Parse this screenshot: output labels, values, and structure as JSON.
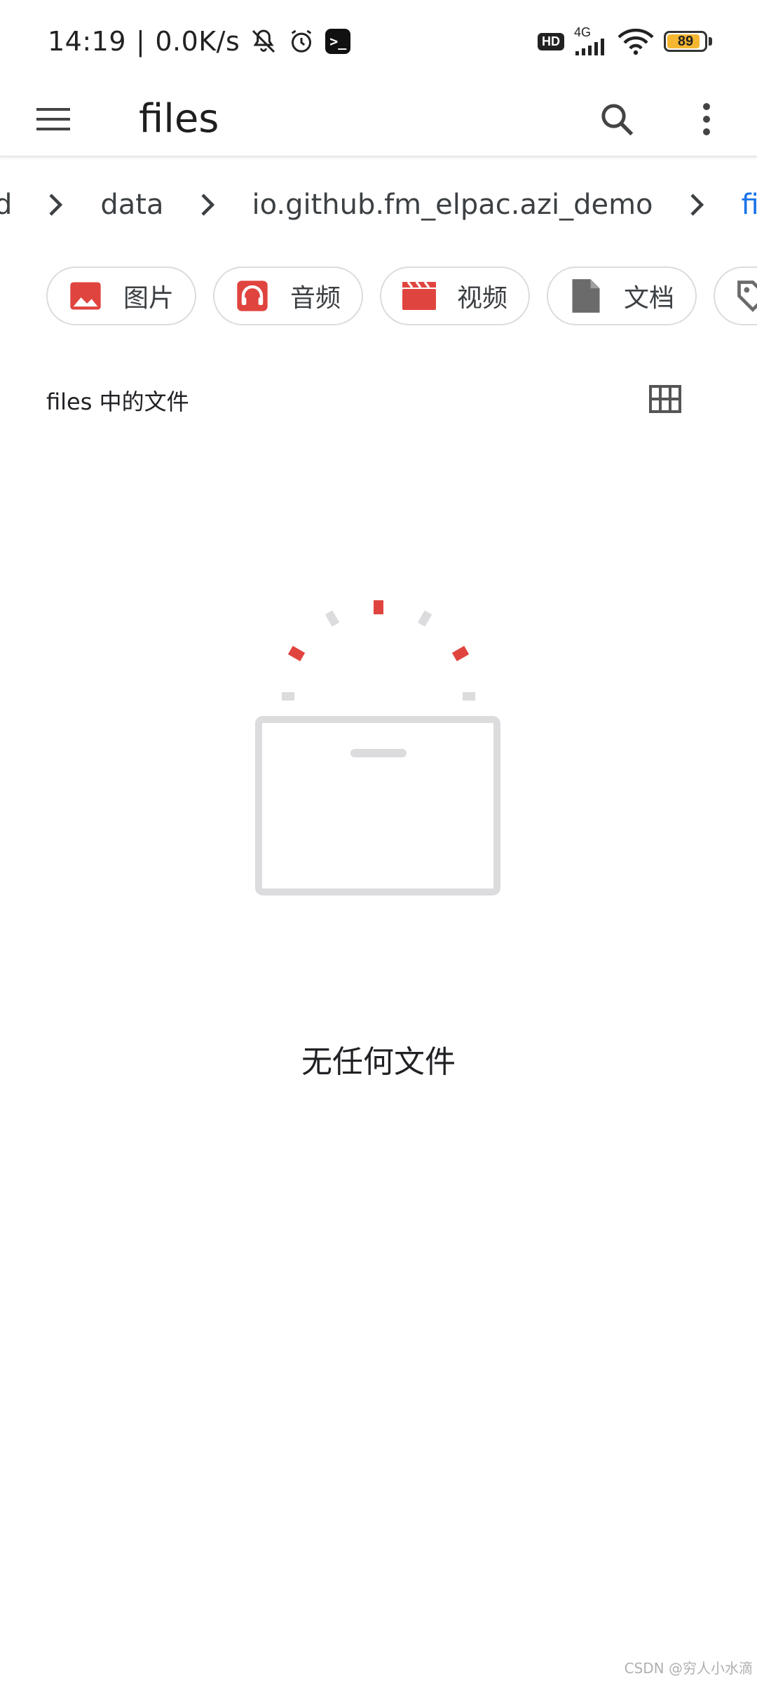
{
  "status_bar": {
    "time": "14:19",
    "net_speed": "0.0K/s",
    "hd": "HD",
    "network_type": "4G",
    "battery_level": "89",
    "battery_fraction": 0.89,
    "battery_color": "#f5b731"
  },
  "app_bar": {
    "title": "files",
    "icons": [
      "menu-icon",
      "search-icon",
      "more-vert-icon"
    ]
  },
  "breadcrumb": {
    "items": [
      "d",
      "data",
      "io.github.fm_elpac.azi_demo",
      "files"
    ],
    "active_color": "#1a73e8"
  },
  "chips": [
    {
      "label": "图片",
      "icon": "image-icon",
      "color": "#e0443e"
    },
    {
      "label": "音频",
      "icon": "headphones-icon",
      "color": "#e0443e"
    },
    {
      "label": "视频",
      "icon": "video-icon",
      "color": "#e0443e"
    },
    {
      "label": "文档",
      "icon": "document-icon",
      "color": "#6b6b6b"
    },
    {
      "label": "",
      "icon": "tag-icon",
      "color": "#6b6b6b"
    }
  ],
  "section": {
    "title": "files 中的文件",
    "view_icon": "grid-view-icon"
  },
  "empty_state": {
    "message": "无任何文件",
    "accent_color": "#e0443e",
    "muted_color": "#dcdcdf"
  },
  "watermark": "CSDN @穷人小水滴"
}
